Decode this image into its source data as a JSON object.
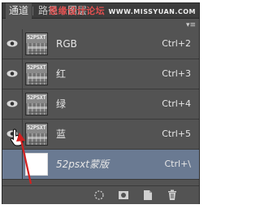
{
  "tabs": [
    {
      "label": "通道",
      "active": true
    },
    {
      "label": "路径",
      "active": false
    },
    {
      "label": "图层",
      "active": false
    }
  ],
  "watermark": {
    "part1": "思缘设计论坛",
    "part2": "WWW.MISSYUAN.COM"
  },
  "thumbnail_text": "52PSXT",
  "channels": [
    {
      "name": "RGB",
      "shortcut": "Ctrl+2",
      "visible": true,
      "selected": false
    },
    {
      "name": "红",
      "shortcut": "Ctrl+3",
      "visible": true,
      "selected": false
    },
    {
      "name": "绿",
      "shortcut": "Ctrl+4",
      "visible": true,
      "selected": false
    },
    {
      "name": "蓝",
      "shortcut": "Ctrl+5",
      "visible": true,
      "selected": false
    },
    {
      "name": "52psxt蒙版",
      "shortcut": "Ctrl+\\",
      "visible": false,
      "selected": true
    }
  ],
  "bottom_tools": [
    {
      "icon": "load-selection-icon"
    },
    {
      "icon": "save-selection-icon"
    },
    {
      "icon": "new-channel-icon"
    },
    {
      "icon": "delete-icon"
    }
  ],
  "colors": {
    "panel_bg": "#535353",
    "selected_row": "#6a7a92",
    "annotation_arrow": "#d42020"
  }
}
